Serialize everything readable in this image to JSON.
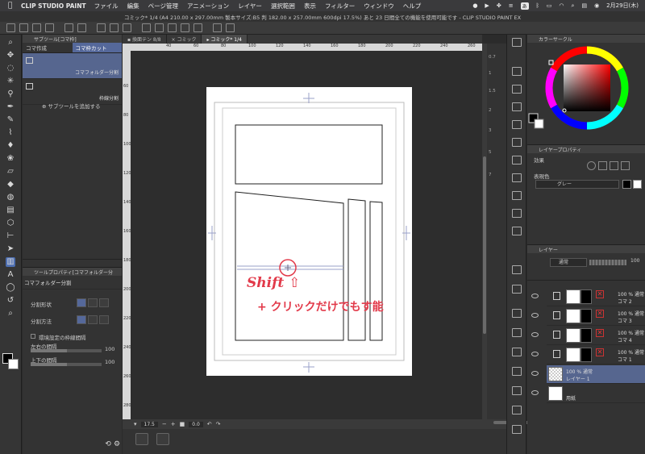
{
  "menubar": {
    "app": "CLIP STUDIO PAINT",
    "items": [
      "ファイル",
      "編集",
      "ページ管理",
      "アニメーション",
      "レイヤー",
      "選択範囲",
      "表示",
      "フィルター",
      "ウィンドウ",
      "ヘルプ"
    ],
    "input_method": "あ",
    "date": "2月29日(木)"
  },
  "window": {
    "title": "コミック* 1/4 (A4 210.00 x 297.00mm 製本サイズ:B5 判 182.00 x 257.00mm 600dpi 17.5%)  あと 23 日間全ての機能を使用可能です - CLIP STUDIO PAINT EX"
  },
  "canvas_tabs": [
    {
      "label": "▪ 換面テン  8/8"
    },
    {
      "label": "× コミック"
    },
    {
      "label": "▸ コミック*   1/4"
    }
  ],
  "subtool_panel": {
    "header": "サブツール[コマ枠]",
    "tab1": "コマ作成",
    "tab2": "コマ枠カット",
    "item1": "コマフォルダー分割",
    "item2": "枠線分割",
    "add_label": "サブツールを追加する"
  },
  "tool_property": {
    "header": "ツールプロパティ[コマフォルダー分",
    "subtitle": "コマフォルダー分割",
    "shape_label": "分割形状",
    "method_label": "分割方法",
    "checkbox_label": "環境設定の枠線間隔",
    "h_spacing_label": "左右の間隔",
    "h_spacing_value": "100",
    "v_spacing_label": "上下の間隔",
    "v_spacing_value": "100"
  },
  "rulers": {
    "h": [
      "40",
      "60",
      "80",
      "100",
      "120",
      "140",
      "160",
      "180",
      "200",
      "220",
      "240",
      "260"
    ],
    "v": [
      "60",
      "80",
      "100",
      "120",
      "140",
      "160",
      "180",
      "200",
      "220",
      "240",
      "260",
      "280"
    ]
  },
  "zoom_rail": [
    "0.7",
    "1",
    "1.5",
    "2",
    "3",
    "5",
    "7"
  ],
  "navigator": {
    "zoom": "17.5",
    "rotation": "0.0"
  },
  "color_panel": {
    "header": "カラーサークル"
  },
  "layer_property": {
    "header": "レイヤープロパティ",
    "effect_label": "効果",
    "display_color_label": "表現色",
    "display_color_value": "グレー"
  },
  "layer_panel": {
    "header": "レイヤー",
    "blend_mode": "通常",
    "opacity": "100",
    "layers": [
      {
        "opacity": "100 % 通常",
        "name": "コマ 2",
        "selected": false
      },
      {
        "opacity": "100 % 通常",
        "name": "コマ 3",
        "selected": false
      },
      {
        "opacity": "100 % 通常",
        "name": "コマ 4",
        "selected": false
      },
      {
        "opacity": "100 % 通常",
        "name": "コマ 1",
        "selected": false
      },
      {
        "opacity": "100 % 通常",
        "name": "レイヤー 1",
        "selected": true
      },
      {
        "opacity": "",
        "name": "用紙",
        "selected": false
      }
    ]
  },
  "annotation": {
    "line1": "Shift ⇧",
    "line2": "+ クリックだけでもす能"
  },
  "colors": {
    "accent": "#55689a",
    "annotation": "#e23a4a"
  }
}
